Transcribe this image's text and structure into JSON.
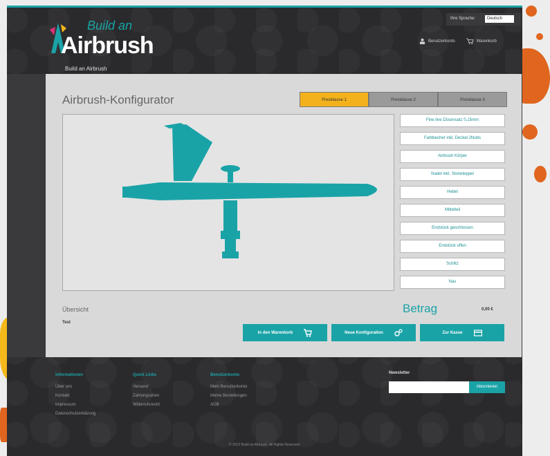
{
  "header": {
    "logo_top": "Build an",
    "logo_main": "Airbrush",
    "language_label": "Ihre Sprache:",
    "language_value": "Deutsch",
    "account_label": "Benutzerkonto",
    "cart_label": "Warenkorb",
    "breadcrumb": "Build an Airbrush"
  },
  "configurator": {
    "title": "Airbrush-Konfigurator",
    "steps": [
      "Preisklasse 1",
      "Preisklasse 2",
      "Preisklasse 3"
    ],
    "options": [
      "Fine line Düsensatz 0,15mm",
      "Farbbecher inkl. Deckel 2Nubs",
      "Airbrush Körper",
      "Nadel inkl. Stoneteppel",
      "Hebel",
      "Mittelteil",
      "Endstück geschlossen",
      "Endstück offen",
      "Schlitz",
      "Nav"
    ],
    "summary_label": "Übersicht",
    "summary_text": "Test",
    "amount_label": "Betrag",
    "amount_value": "0,00 €",
    "actions": [
      "In den Warenkorb",
      "Neue Konfiguration",
      "Zur Kasse"
    ]
  },
  "footer": {
    "col1_title": "Informationen",
    "col1_items": [
      "Über uns",
      "Kontakt",
      "Impressum",
      "Datenschutzerklärung"
    ],
    "col2_title": "Quick Links",
    "col2_items": [
      "Versand",
      "Zahlungsarten",
      "Widerrufsrecht"
    ],
    "col3_title": "Benutzerkonto",
    "col3_items": [
      "Mein Benutzerkonto",
      "Meine Bestellungen",
      "AGB"
    ],
    "newsletter_title": "Newsletter",
    "newsletter_button": "Abonnieren",
    "copyright": "© 2013 Build an Airbrush. All Rights Reserved."
  },
  "colors": {
    "accent": "#1aa3a7",
    "step_active": "#f3b21c",
    "splatter_orange": "#e0651e",
    "splatter_yellow": "#f5b81a"
  }
}
